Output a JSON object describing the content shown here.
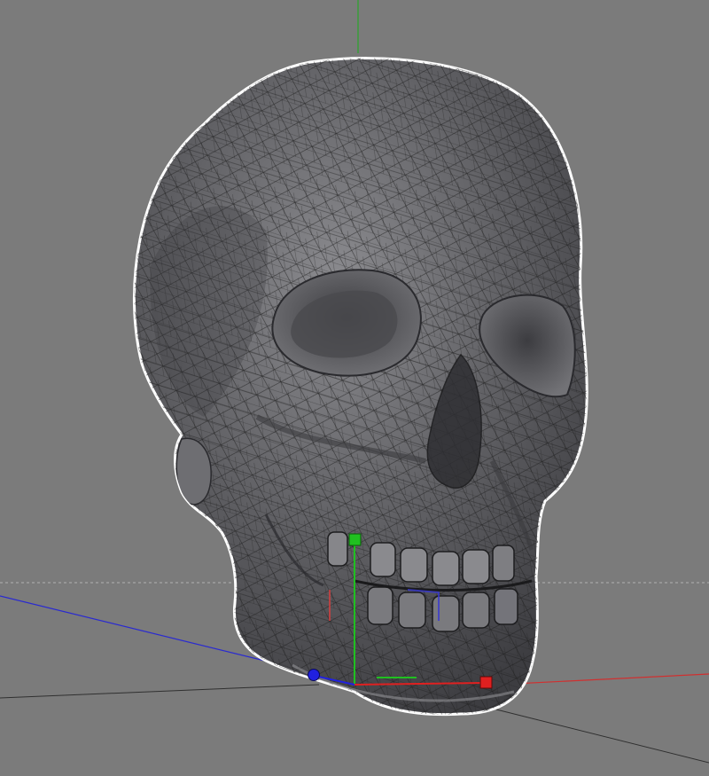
{
  "viewport": {
    "background": "#7b7b7b",
    "object": "skull-mesh",
    "display_mode": "gouraud-shading-wireframe",
    "selected": true,
    "selection_outline_color": "#ffffff",
    "mesh_color": "#5e5e60",
    "wire_color": "#1c1c1c",
    "horizon_color": "#b0b0b0"
  },
  "axes": {
    "x": {
      "name": "x-axis",
      "color": "#d03030"
    },
    "y": {
      "name": "y-axis",
      "color": "#2aa52a"
    },
    "z": {
      "name": "z-axis",
      "color": "#2a2ad0"
    }
  },
  "gizmo": {
    "x_handle_color": "#e02020",
    "y_handle_color": "#20c020",
    "z_handle_color": "#2020e0"
  },
  "icons": [
    "x-axis-handle-icon",
    "y-axis-handle-icon",
    "z-axis-handle-icon"
  ]
}
